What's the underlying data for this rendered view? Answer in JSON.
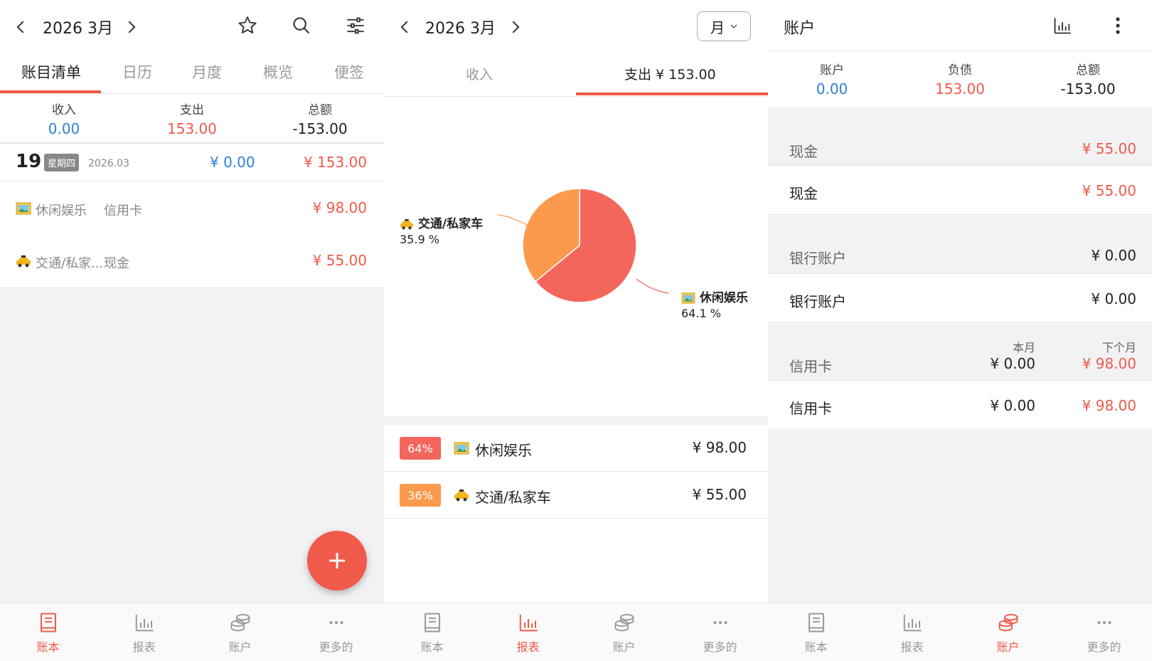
{
  "p1": {
    "month": "2026 3月",
    "tabs": [
      "账目清单",
      "日历",
      "月度",
      "概览",
      "便签"
    ],
    "summary": {
      "income_label": "收入",
      "income_value": "0.00",
      "expense_label": "支出",
      "expense_value": "153.00",
      "total_label": "总额",
      "total_value": "-153.00"
    },
    "day": {
      "number": "19",
      "weekday": "星期四",
      "date": "2026.03",
      "income": "¥ 0.00",
      "expense": "¥ 153.00"
    },
    "entries": [
      {
        "category": "休闲娱乐",
        "account": "信用卡",
        "amount": "¥ 98.00"
      },
      {
        "category": "交通/私家...",
        "account": "现金",
        "amount": "¥ 55.00"
      }
    ]
  },
  "p2": {
    "month": "2026 3月",
    "period": "月",
    "tab_income": "收入",
    "tab_expense": "支出 ¥ 153.00",
    "pie": {
      "label_a": "交通/私家车",
      "pct_a": "35.9 %",
      "label_b": "休闲娱乐",
      "pct_b": "64.1 %"
    },
    "list": [
      {
        "badge": "64%",
        "name": "休闲娱乐",
        "amount": "¥ 98.00",
        "color": "#f4665c"
      },
      {
        "badge": "36%",
        "name": "交通/私家车",
        "amount": "¥ 55.00",
        "color": "#fb9a4c"
      }
    ]
  },
  "p3": {
    "title": "账户",
    "summary": {
      "account_label": "账户",
      "account_value": "0.00",
      "debt_label": "负债",
      "debt_value": "153.00",
      "total_label": "总额",
      "total_value": "-153.00"
    },
    "cash_group": {
      "name": "现金",
      "value": "¥ 55.00"
    },
    "cash_item": {
      "name": "现金",
      "value": "¥ 55.00"
    },
    "bank_group": {
      "name": "银行账户",
      "value": "¥ 0.00"
    },
    "bank_item": {
      "name": "银行账户",
      "value": "¥ 0.00"
    },
    "credit_group": {
      "name": "信用卡",
      "this_month_label": "本月",
      "this_month": "¥ 0.00",
      "next_month_label": "下个月",
      "next_month": "¥ 98.00"
    },
    "credit_item": {
      "name": "信用卡",
      "this_month": "¥ 0.00",
      "next_month": "¥ 98.00"
    }
  },
  "nav": [
    "账本",
    "报表",
    "账户",
    "更多的"
  ],
  "colors": {
    "accent": "#f05a4a",
    "blue": "#2f7fd9",
    "orange": "#fb9a4c"
  },
  "chart_data": {
    "type": "pie",
    "categories": [
      "休闲娱乐",
      "交通/私家车"
    ],
    "values": [
      64.1,
      35.9
    ]
  }
}
